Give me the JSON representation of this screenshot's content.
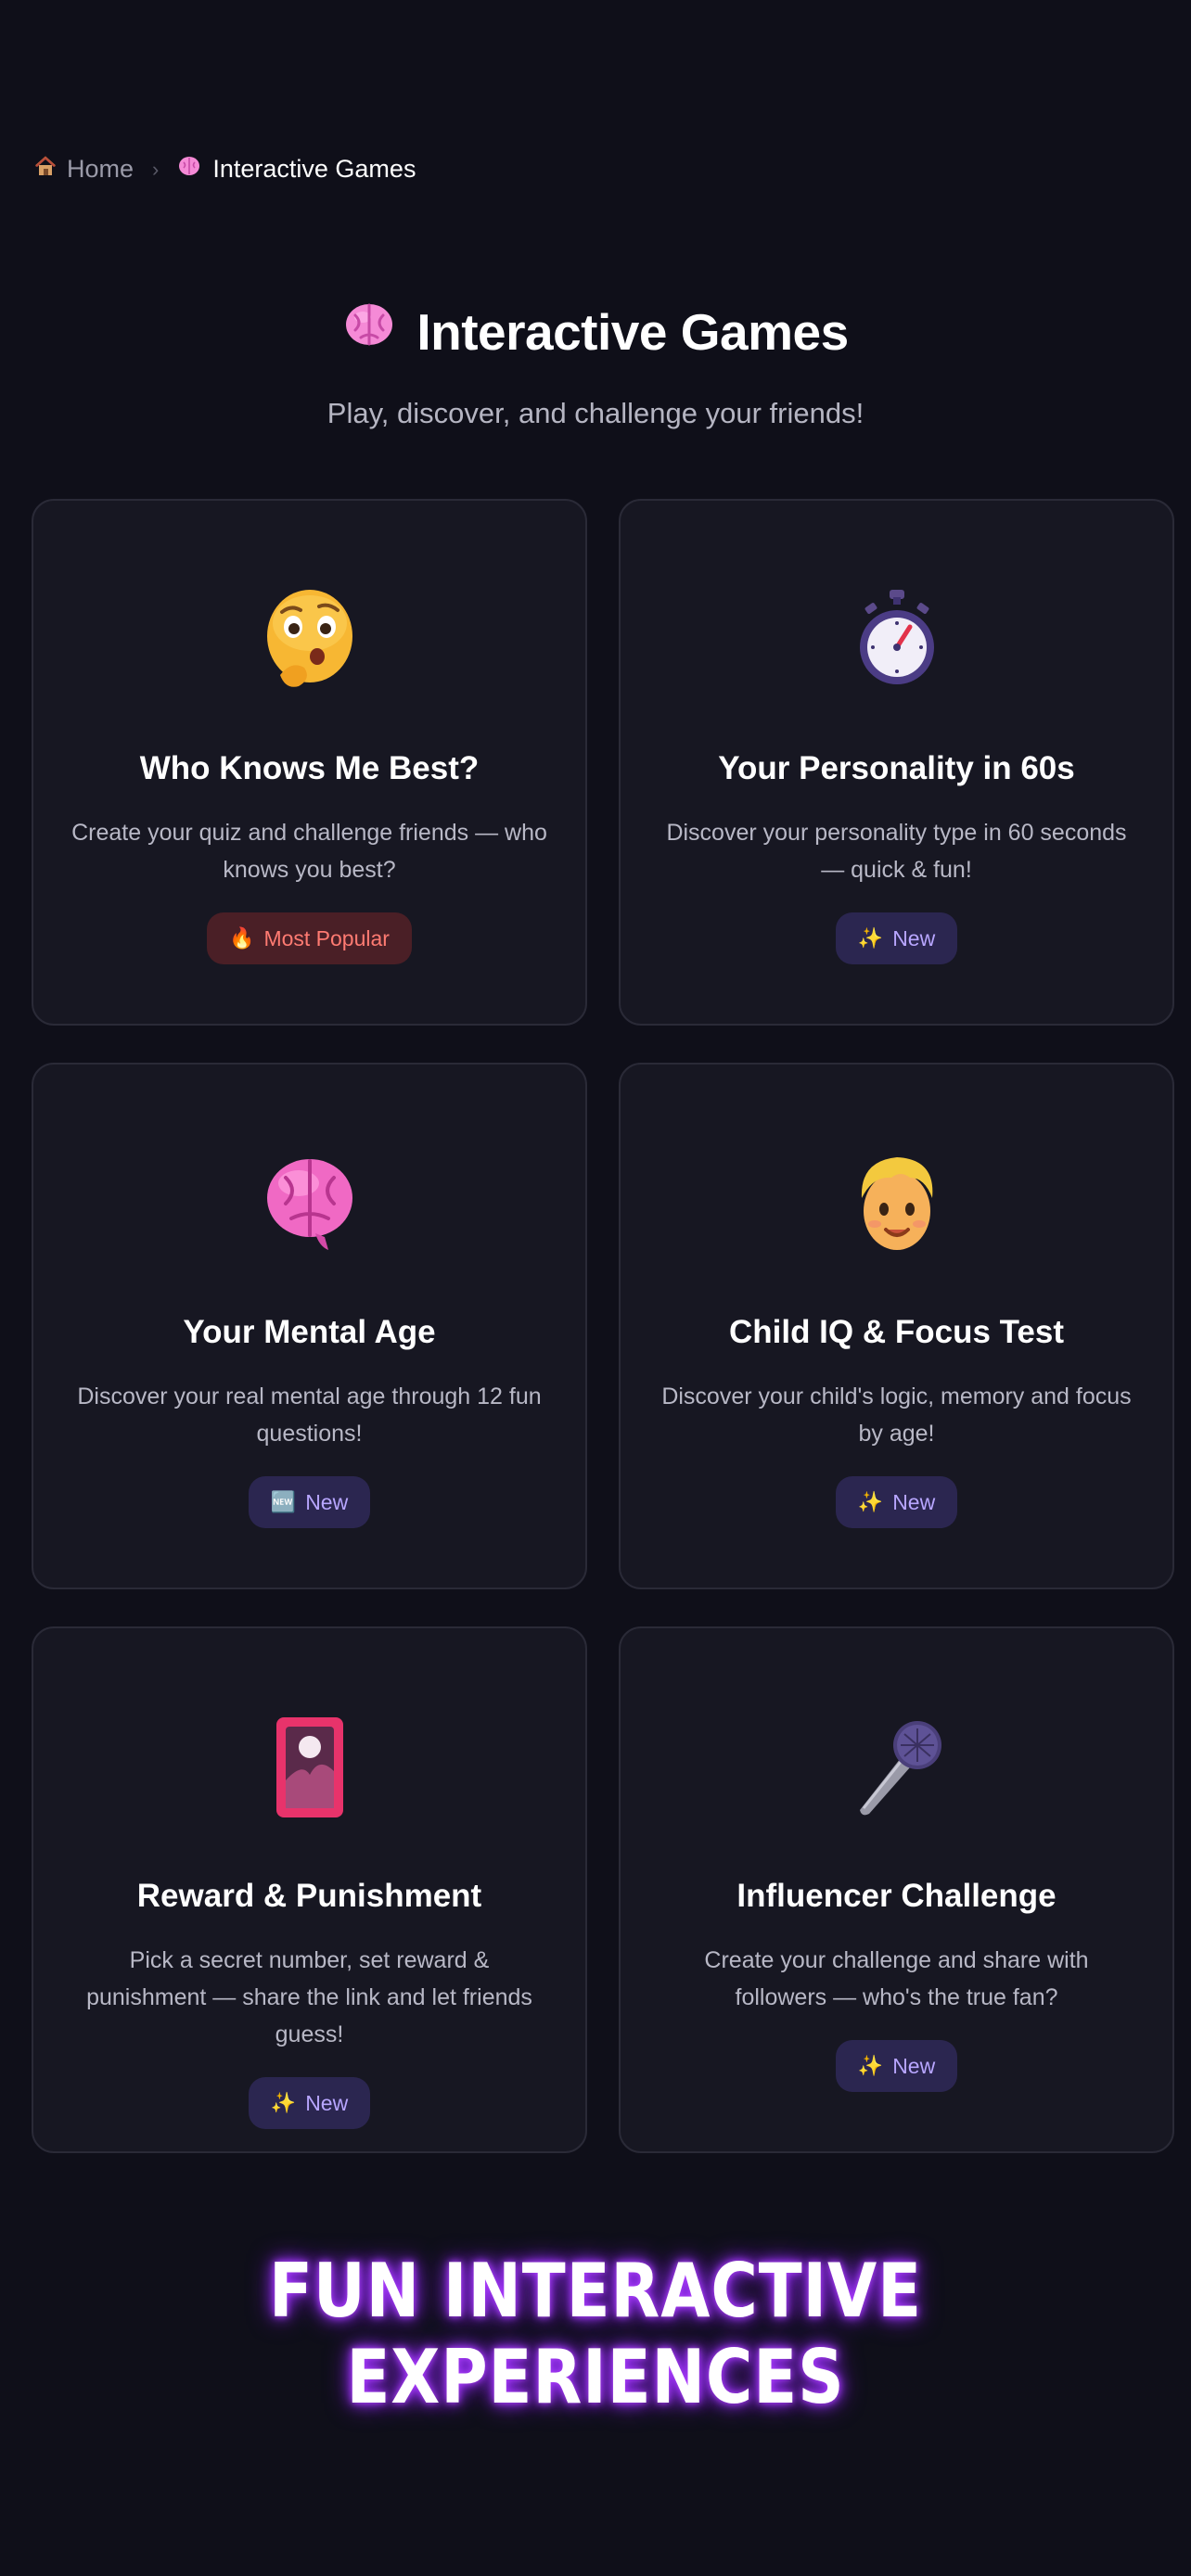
{
  "breadcrumb": {
    "home_icon": "house-icon",
    "home_label": "Home",
    "separator": "›",
    "current_icon": "brain-icon",
    "current_label": "Interactive Games"
  },
  "header": {
    "icon": "brain-icon",
    "title": "Interactive Games",
    "subtitle": "Play, discover, and challenge your friends!"
  },
  "games": [
    {
      "icon": "thinking-face-icon",
      "title": "Who Knows Me Best?",
      "description": "Create your quiz and challenge friends — who knows you best?",
      "badge_icon": "🔥",
      "badge_label": "Most Popular",
      "badge_type": "popular"
    },
    {
      "icon": "stopwatch-icon",
      "title": "Your Personality in 60s",
      "description": "Discover your personality type in 60 seconds — quick & fun!",
      "badge_icon": "✨",
      "badge_label": "New",
      "badge_type": "new"
    },
    {
      "icon": "brain-icon",
      "title": "Your Mental Age",
      "description": "Discover your real mental age through 12 fun questions!",
      "badge_icon": "🆕",
      "badge_label": "New",
      "badge_type": "new"
    },
    {
      "icon": "child-face-icon",
      "title": "Child IQ & Focus Test",
      "description": "Discover your child's logic, memory and focus by age!",
      "badge_icon": "✨",
      "badge_label": "New",
      "badge_type": "new"
    },
    {
      "icon": "playing-card-icon",
      "title": "Reward & Punishment",
      "description": "Pick a secret number, set reward & punishment — share the link and let friends guess!",
      "badge_icon": "✨",
      "badge_label": "New",
      "badge_type": "new"
    },
    {
      "icon": "microphone-icon",
      "title": "Influencer Challenge",
      "description": "Create your challenge and share with followers — who's the true fan?",
      "badge_icon": "✨",
      "badge_label": "New",
      "badge_type": "new"
    }
  ],
  "tagline": "FUN INTERACTIVE EXPERIENCES",
  "colors": {
    "background": "#0f0f19",
    "card": "#171722",
    "badge_new_bg": "#2b2650",
    "badge_new_text": "#b8a6ff",
    "badge_popular_bg": "#4a1f26",
    "badge_popular_text": "#ff7b72",
    "tagline_glow": "#9b30ff"
  }
}
